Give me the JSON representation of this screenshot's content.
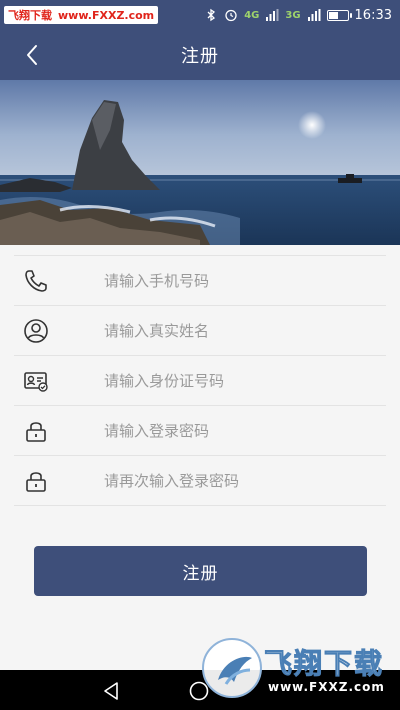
{
  "status_bar": {
    "watermark_name": "飞翔下载",
    "watermark_url": "www.FXXZ.com",
    "network": "4G",
    "network2": "3G",
    "time": "16:33",
    "battery_level": 0.5
  },
  "header": {
    "title": "注册"
  },
  "form": {
    "fields": [
      {
        "placeholder": "请输入手机号码",
        "value": "",
        "icon": "phone-icon"
      },
      {
        "placeholder": "请输入真实姓名",
        "value": "",
        "icon": "user-icon"
      },
      {
        "placeholder": "请输入身份证号码",
        "value": "",
        "icon": "id-card-icon"
      },
      {
        "placeholder": "请输入登录密码",
        "value": "",
        "icon": "lock-icon"
      },
      {
        "placeholder": "请再次输入登录密码",
        "value": "",
        "icon": "lock-icon"
      }
    ]
  },
  "register_button": {
    "label": "注册"
  },
  "watermark": {
    "title": "飞翔下载",
    "url": "www.FXXZ.com"
  },
  "colors": {
    "primary": "#3e4f7a",
    "background": "#f5f5f5",
    "divider": "#e3e3e3",
    "placeholder": "#9a9a9a"
  }
}
